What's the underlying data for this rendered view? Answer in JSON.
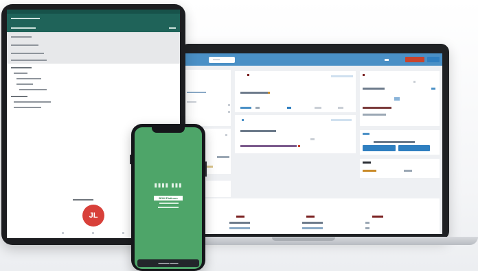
{
  "devices": {
    "laptop": {
      "accent_color": "#4a90c6",
      "alert_color": "#c9432c",
      "button_color": "#2f7fc0"
    },
    "tablet": {
      "header_color": "#1f6359",
      "seal_text": "JL",
      "seal_color": "#d8403a"
    },
    "phone": {
      "background_color": "#4ea569",
      "badge_text": "BOM Platinum"
    }
  }
}
